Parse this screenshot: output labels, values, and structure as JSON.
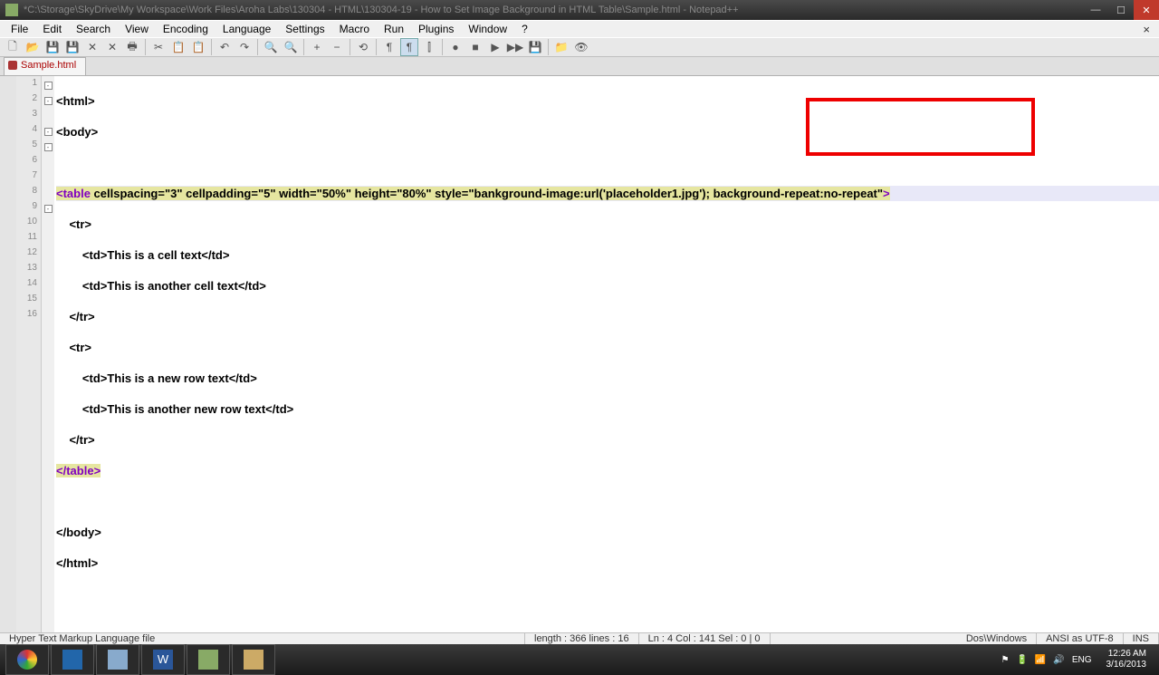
{
  "titlebar": {
    "title": "*C:\\Storage\\SkyDrive\\My Workspace\\Work Files\\Aroha Labs\\130304 - HTML\\130304-19 - How to Set Image Background in HTML Table\\Sample.html - Notepad++"
  },
  "menu": {
    "file": "File",
    "edit": "Edit",
    "search": "Search",
    "view": "View",
    "encoding": "Encoding",
    "language": "Language",
    "settings": "Settings",
    "macro": "Macro",
    "run": "Run",
    "plugins": "Plugins",
    "window": "Window",
    "help": "?"
  },
  "tab": {
    "label": "Sample.html"
  },
  "code": {
    "l1": "<html>",
    "l2": "<body>",
    "l3": "",
    "l4_pre": "<",
    "l4_tag": "table",
    "l4_a1": " cellspacing=\"3\"",
    "l4_a2": " cellpadding=\"5\"",
    "l4_a3": " width=\"50%\"",
    "l4_a4": " height=\"80%\"",
    "l4_a5": " style=\"bankground-image:url('placeholder1.jpg');",
    "l4_a6": " background-repeat:no-repeat\"",
    "l4_end": ">",
    "l5": "    <tr>",
    "l6": "        <td>This is a cell text</td>",
    "l7": "        <td>This is another cell text</td>",
    "l8": "    </tr>",
    "l9": "    <tr>",
    "l10": "        <td>This is a new row text</td>",
    "l11": "        <td>This is another new row text</td>",
    "l12": "    </tr>",
    "l13_pre": "</",
    "l13_tag": "table",
    "l13_end": ">",
    "l14": "",
    "l15": "</body>",
    "l16": "</html>"
  },
  "status": {
    "filetype": "Hyper Text Markup Language file",
    "length": "length : 366    lines : 16",
    "pos": "Ln : 4    Col : 141    Sel : 0 | 0",
    "eol": "Dos\\Windows",
    "enc": "ANSI as UTF-8",
    "ins": "INS"
  },
  "tray": {
    "lang": "ENG",
    "time": "12:26 AM",
    "date": "3/16/2013"
  }
}
